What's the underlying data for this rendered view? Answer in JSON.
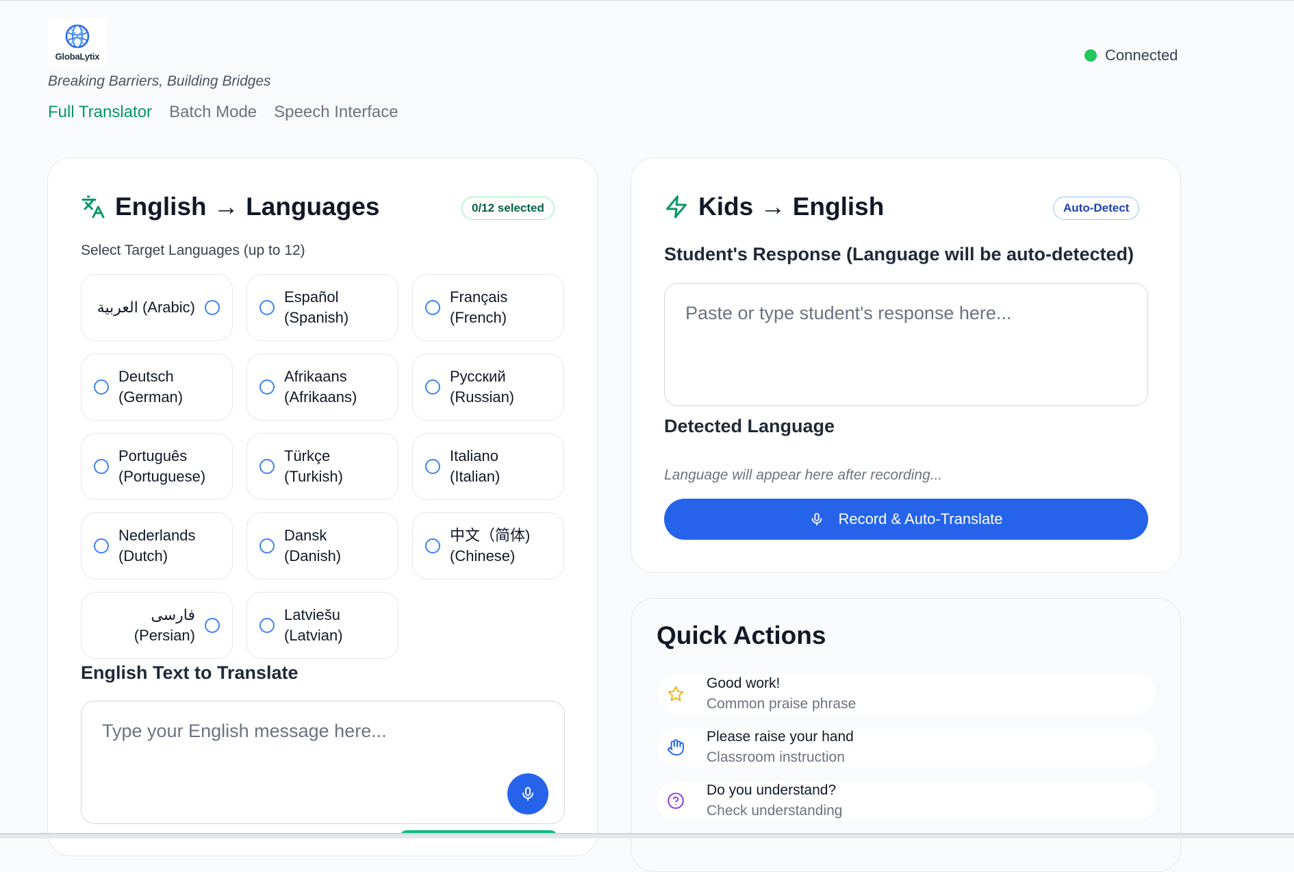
{
  "brand": {
    "name": "GlobaLytix",
    "tagline": "Breaking Barriers, Building Bridges"
  },
  "nav": {
    "tabs": [
      {
        "label": "Full Translator",
        "active": true
      },
      {
        "label": "Batch Mode",
        "active": false
      },
      {
        "label": "Speech Interface",
        "active": false
      }
    ]
  },
  "status": {
    "label": "Connected",
    "color": "#22c55e"
  },
  "translator": {
    "title": "English → Languages",
    "selected_badge": "0/12 selected",
    "languages_label": "Select Target Languages (up to 12)",
    "languages": [
      {
        "native": "العربية",
        "english": "(Arabic)",
        "rtl": true
      },
      {
        "native": "Español",
        "english": "(Spanish)"
      },
      {
        "native": "Français",
        "english": "(French)"
      },
      {
        "native": "Deutsch",
        "english": "(German)"
      },
      {
        "native": "Afrikaans",
        "english": "(Afrikaans)"
      },
      {
        "native": "Русский",
        "english": "(Russian)"
      },
      {
        "native": "Português",
        "english": "(Portuguese)"
      },
      {
        "native": "Türkçe",
        "english": "(Turkish)"
      },
      {
        "native": "Italiano",
        "english": "(Italian)"
      },
      {
        "native": "Nederlands",
        "english": "(Dutch)"
      },
      {
        "native": "Dansk",
        "english": "(Danish)"
      },
      {
        "native": "中文（简体)",
        "english": "(Chinese)"
      },
      {
        "native": "فارسی",
        "english": "(Persian)",
        "rtl": true
      },
      {
        "native": "Latviešu",
        "english": "(Latvian)"
      }
    ],
    "text_label": "English Text to Translate",
    "text_placeholder": "Type your English message here..."
  },
  "kids": {
    "title": "Kids → English",
    "badge": "Auto-Detect",
    "response_label": "Student's Response (Language will be auto-detected)",
    "response_placeholder": "Paste or type student's response here...",
    "detected_label": "Detected Language",
    "detected_hint": "Language will appear here after recording...",
    "record_button": "Record & Auto-Translate"
  },
  "quick_actions": {
    "title": "Quick Actions",
    "items": [
      {
        "icon": "star-icon",
        "title": "Good work!",
        "subtitle": "Common praise phrase",
        "color": "#eab308"
      },
      {
        "icon": "hand-icon",
        "title": "Please raise your hand",
        "subtitle": "Classroom instruction",
        "color": "#2563eb"
      },
      {
        "icon": "question-icon",
        "title": "Do you understand?",
        "subtitle": "Check understanding",
        "color": "#9333ea"
      }
    ]
  },
  "colors": {
    "accent_green": "#059669",
    "primary_blue": "#2563eb"
  }
}
